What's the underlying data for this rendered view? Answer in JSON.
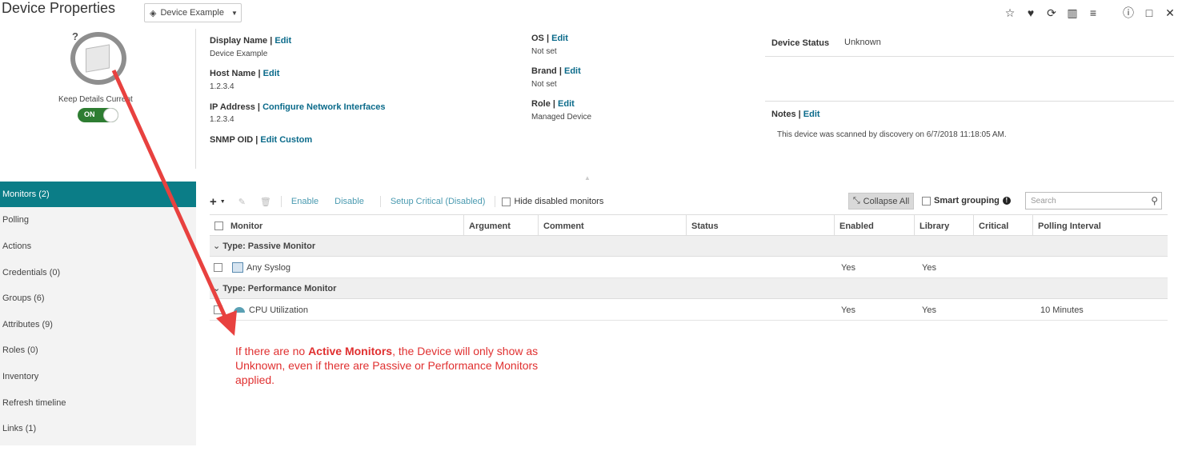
{
  "header": {
    "title": "Device Properties",
    "device_selector": "Device Example"
  },
  "left": {
    "keep_details_label": "Keep Details Current",
    "toggle_label": "ON"
  },
  "properties": {
    "display_name_label": "Display Name",
    "display_name_edit": "Edit",
    "display_name_value": "Device Example",
    "host_name_label": "Host Name",
    "host_name_edit": "Edit",
    "host_name_value": "1.2.3.4",
    "ip_label": "IP Address",
    "ip_edit": "Configure Network Interfaces",
    "ip_value": "1.2.3.4",
    "snmp_label": "SNMP OID",
    "snmp_edit": "Edit Custom",
    "os_label": "OS",
    "os_edit": "Edit",
    "os_value": "Not set",
    "brand_label": "Brand",
    "brand_edit": "Edit",
    "brand_value": "Not set",
    "role_label": "Role",
    "role_edit": "Edit",
    "role_value": "Managed Device",
    "status_label": "Device Status",
    "status_value": "Unknown",
    "notes_label": "Notes",
    "notes_edit": "Edit",
    "notes_value": "This device was scanned by discovery on 6/7/2018 11:18:05 AM."
  },
  "sidebar": {
    "items": [
      {
        "label": "Monitors (2)"
      },
      {
        "label": "Polling"
      },
      {
        "label": "Actions"
      },
      {
        "label": "Credentials (0)"
      },
      {
        "label": "Groups (6)"
      },
      {
        "label": "Attributes (9)"
      },
      {
        "label": "Roles (0)"
      },
      {
        "label": "Inventory"
      },
      {
        "label": "Refresh timeline"
      },
      {
        "label": "Links (1)"
      }
    ]
  },
  "toolbar": {
    "enable": "Enable",
    "disable": "Disable",
    "setup_critical": "Setup Critical (Disabled)",
    "hide_disabled": "Hide disabled monitors",
    "collapse_all": "Collapse All",
    "smart_grouping": "Smart grouping",
    "search_placeholder": "Search"
  },
  "grid": {
    "columns": [
      "Monitor",
      "Argument",
      "Comment",
      "Status",
      "Enabled",
      "Library",
      "Critical",
      "Polling Interval"
    ],
    "groups": [
      {
        "label": "Type: Passive Monitor",
        "rows": [
          {
            "monitor": "Any Syslog",
            "argument": "",
            "comment": "",
            "status": "",
            "enabled": "Yes",
            "library": "Yes",
            "critical": "",
            "polling": ""
          }
        ]
      },
      {
        "label": "Type: Performance Monitor",
        "rows": [
          {
            "monitor": "CPU Utilization",
            "argument": "",
            "comment": "",
            "status": "",
            "enabled": "Yes",
            "library": "Yes",
            "critical": "",
            "polling": "10 Minutes"
          }
        ]
      }
    ]
  },
  "annotation": {
    "text_before": "If there are no ",
    "text_bold": "Active Monitors",
    "text_after": ", the Device will only show as Unknown, even if there are Passive or Performance Monitors applied.",
    "color": "#e03030"
  }
}
